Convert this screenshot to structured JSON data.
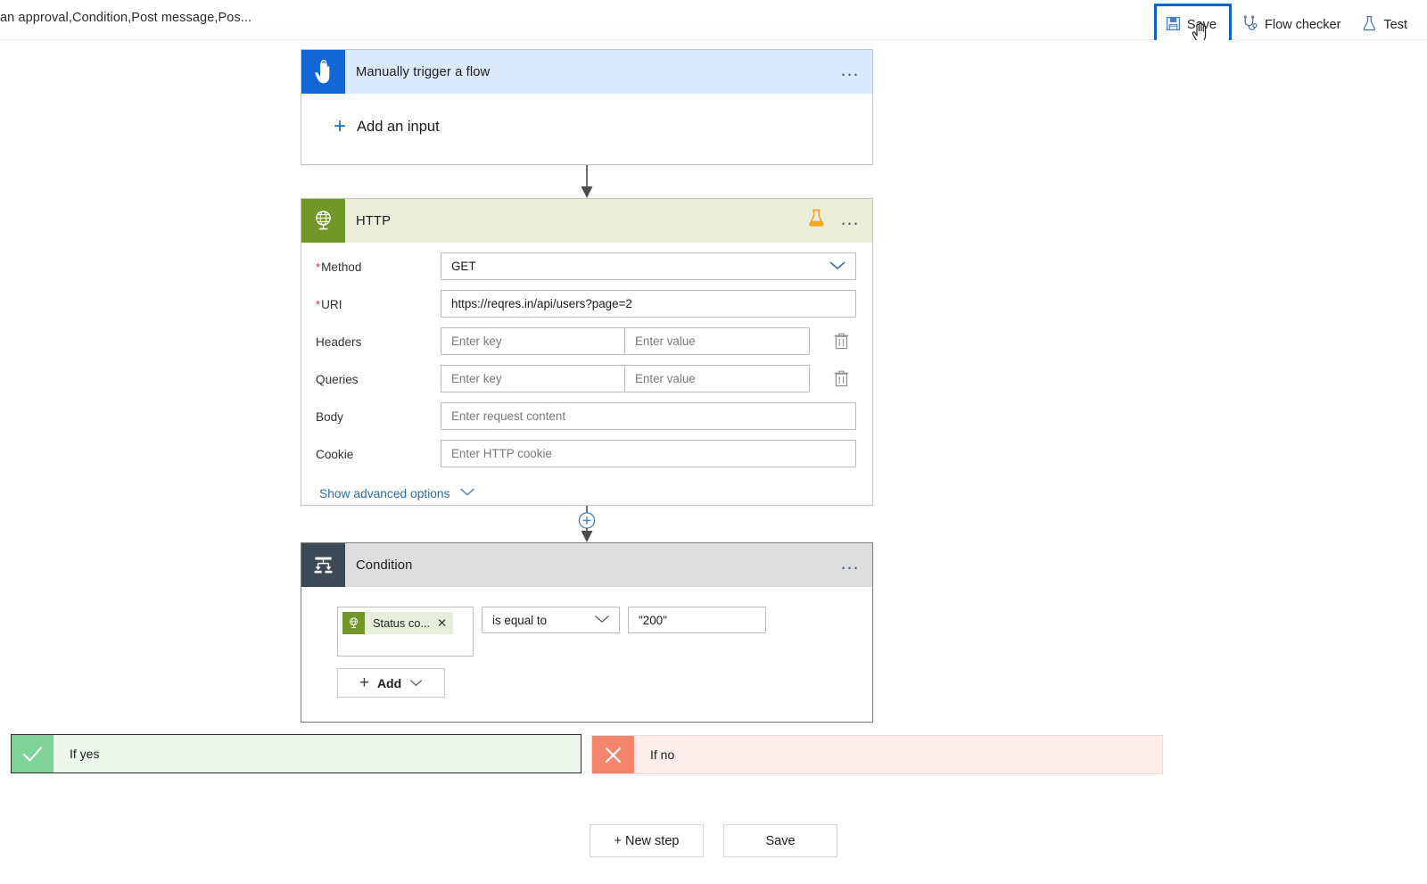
{
  "topbar": {
    "breadcrumb": "an approval,Condition,Post message,Pos...",
    "save_label": "Save",
    "save_tooltip": "Save",
    "flow_checker_label": "Flow checker",
    "test_label": "Test",
    "save_icon": "floppy-disk-icon",
    "flow_checker_icon": "stethoscope-icon",
    "test_icon": "flask-icon",
    "cursor_icon": "pointing-hand-cursor",
    "focus_color": "#0f62bd"
  },
  "trigger_card": {
    "title": "Manually trigger a flow",
    "icon": "touch-hand-icon",
    "icon_bg": "#1267d4",
    "header_bg": "#dbeafd",
    "menu_icon": "ellipsis-icon",
    "add_input_label": "Add an input",
    "add_input_icon": "plus-icon"
  },
  "http_card": {
    "title": "HTTP",
    "icon": "globe-network-icon",
    "icon_bg": "#709727",
    "header_bg": "#eaeed8",
    "premium_icon": "flask-icon",
    "premium_color": "#f2a23a",
    "menu_icon": "ellipsis-icon",
    "fields": [
      {
        "label": "Method",
        "required": true,
        "type": "dropdown",
        "value": "GET",
        "placeholder": ""
      },
      {
        "label": "URI",
        "required": true,
        "type": "text",
        "value": "https://reqres.in/api/users?page=2",
        "placeholder": ""
      },
      {
        "label": "Headers",
        "required": false,
        "type": "keyvalue",
        "key_placeholder": "Enter key",
        "value_placeholder": "Enter value",
        "delete_icon": "trash-icon"
      },
      {
        "label": "Queries",
        "required": false,
        "type": "keyvalue",
        "key_placeholder": "Enter key",
        "value_placeholder": "Enter value",
        "delete_icon": "trash-icon"
      },
      {
        "label": "Body",
        "required": false,
        "type": "text",
        "value": "",
        "placeholder": "Enter request content"
      },
      {
        "label": "Cookie",
        "required": false,
        "type": "text",
        "value": "",
        "placeholder": "Enter HTTP cookie"
      }
    ],
    "advanced_label": "Show advanced options",
    "advanced_icon": "chevron-down-icon"
  },
  "condition_card": {
    "title": "Condition",
    "icon": "condition-branch-icon",
    "icon_bg": "#3b4a56",
    "header_bg": "#dedede",
    "menu_icon": "ellipsis-icon",
    "token": {
      "label": "Status co...",
      "icon": "globe-network-icon",
      "icon_bg": "#709727",
      "remove_icon": "close-x-icon"
    },
    "operator": "is equal to",
    "operator_icon": "chevron-down-icon",
    "value": "\"200\"",
    "add_label": "Add",
    "add_plus_icon": "plus-icon",
    "add_chevron_icon": "chevron-down-icon"
  },
  "branches": {
    "yes": {
      "label": "If yes",
      "icon": "checkmark-icon",
      "icon_bg": "#7ed396",
      "bg": "#edf7ee"
    },
    "no": {
      "label": "If no",
      "icon": "close-x-icon",
      "icon_bg": "#f4846c",
      "bg": "#fdeeeb"
    }
  },
  "connectors": {
    "add_step_icon": "circle-plus-icon",
    "arrow_icon": "down-arrow-icon"
  },
  "bottom": {
    "new_step_label": "+ New step",
    "save_label": "Save"
  }
}
